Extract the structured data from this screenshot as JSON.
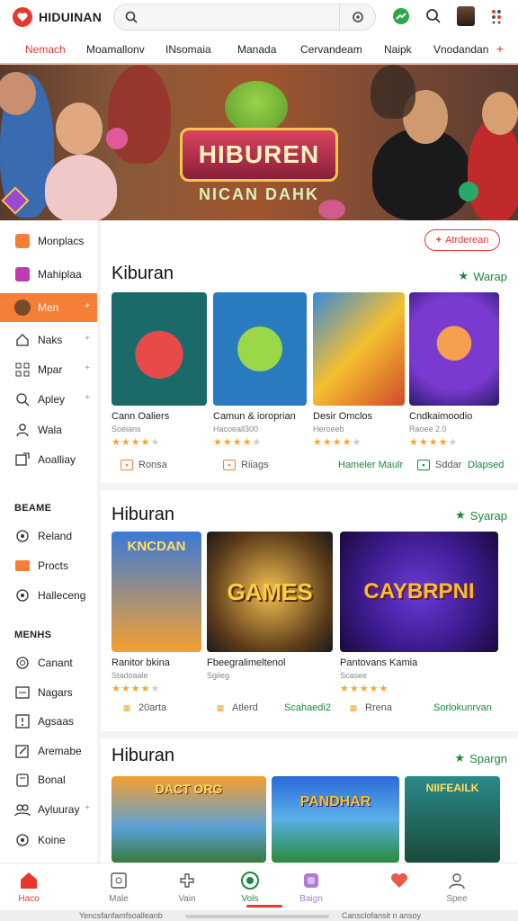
{
  "app": {
    "name": "HIDUINAN"
  },
  "search": {
    "placeholder": ""
  },
  "tabs": [
    "Nemach",
    "Moamallonv",
    "INsomaia",
    "Manada",
    "Cervandeam",
    "Naipk",
    "Vnodandan"
  ],
  "tab_more": "+",
  "banner": {
    "title": "HIBUREN",
    "subtitle": "NICAN DAHK"
  },
  "sidebar": {
    "items": [
      {
        "label": "Monplacs",
        "icon": "grid-icon"
      },
      {
        "label": "Mahiplaa",
        "icon": "puzzle-icon"
      },
      {
        "label": "Men",
        "icon": "avatar-icon",
        "chevron": "+"
      },
      {
        "label": "Naks",
        "icon": "home-icon",
        "chevron": "+"
      },
      {
        "label": "Mpar",
        "icon": "grid-icon",
        "chevron": "+"
      },
      {
        "label": "Apley",
        "icon": "search-icon",
        "chevron": "+"
      },
      {
        "label": "Wala",
        "icon": "user-icon"
      },
      {
        "label": "Aoalliay",
        "icon": "share-icon"
      }
    ],
    "section1_title": "BEAME",
    "section1_items": [
      {
        "label": "Reland",
        "icon": "circle-icon"
      },
      {
        "label": "Procts",
        "icon": "box-icon"
      },
      {
        "label": "Halleceng",
        "icon": "circle-icon"
      }
    ],
    "section2_title": "MENHS",
    "section2_items": [
      {
        "label": "Canant",
        "icon": "refresh-icon"
      },
      {
        "label": "Nagars",
        "icon": "list-icon"
      },
      {
        "label": "Agsaas",
        "icon": "alert-icon"
      },
      {
        "label": "Aremabe",
        "icon": "edit-icon"
      },
      {
        "label": "Bonal",
        "icon": "file-icon"
      },
      {
        "label": "Ayluuray",
        "icon": "people-icon",
        "chevron": "+"
      },
      {
        "label": "Koine",
        "icon": "circle-icon"
      }
    ]
  },
  "add_button": {
    "label": "Atrderean"
  },
  "sections": [
    {
      "title": "Kiburan",
      "link": "Warap",
      "tiles": [
        {
          "name": "Cann Oaliers",
          "sub": "Soeians",
          "rating": 4
        },
        {
          "name": "Camun & ioroprian",
          "sub": "Hacoeall300",
          "rating": 4
        },
        {
          "name": "Desir Omclos",
          "sub": "Heroeeb",
          "rating": 4
        },
        {
          "name": "Cndkaimoodio",
          "sub": "Raoee 2.0",
          "rating": 4
        }
      ],
      "meta": [
        {
          "label": "Ronsa"
        },
        {
          "label": "Riiags"
        },
        {
          "label": "Hameler Maulr"
        },
        {
          "label": "Sddar"
        },
        {
          "label": "Dlapsed"
        }
      ]
    },
    {
      "title": "Hiburan",
      "link": "Syarap",
      "tiles": [
        {
          "name": "Ranitor bkina",
          "sub": "Stadoaale",
          "rating": 4,
          "art_text": "KNCDAN"
        },
        {
          "name": "Fbeegralimeltenol",
          "sub": "Sgiieg",
          "rating": 4,
          "art_text": "GAMES"
        },
        {
          "name": "Pantovans Kamia",
          "sub": "Scasee",
          "rating": 5,
          "art_text": "CAYBRPNI"
        }
      ],
      "meta": [
        {
          "label": "20arta"
        },
        {
          "label": "Atlerd"
        },
        {
          "label": "Scahaedi2"
        },
        {
          "label": "Rrena"
        },
        {
          "label": "Sorlokunrvan"
        }
      ]
    },
    {
      "title": "Hiburan",
      "link": "Spargn",
      "tiles": [
        {
          "name": "",
          "sub": "",
          "rating": 0,
          "art_text": "DACT ORG"
        },
        {
          "name": "",
          "sub": "",
          "rating": 0,
          "art_text": "PANDHAR"
        },
        {
          "name": "",
          "sub": "",
          "rating": 0,
          "art_text": "NIIFEAILK"
        }
      ]
    }
  ],
  "bottom_nav": [
    {
      "label": "Haco",
      "icon": "home-icon"
    },
    {
      "label": "Male",
      "icon": "box-icon"
    },
    {
      "label": "Vain",
      "icon": "puzzle-icon"
    },
    {
      "label": "Vols",
      "icon": "target-icon"
    },
    {
      "label": "Baign",
      "icon": "gamepad-icon"
    },
    {
      "label": "",
      "icon": "heart-icon"
    },
    {
      "label": "Spee",
      "icon": "user-icon"
    }
  ],
  "system_bar": {
    "left": "Yencsfanfamfsoalleanb",
    "right": "Cansclofansit n ansoy"
  },
  "colors": {
    "accent": "#e8372b",
    "sidebar_active": "#f57f36",
    "link_green": "#1a8a3a",
    "star": "#f5a623"
  }
}
